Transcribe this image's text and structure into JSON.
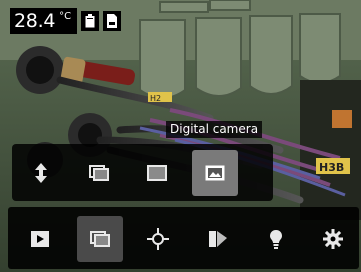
{
  "status": {
    "temperature": "28.4",
    "unit": "°C",
    "battery_icon": "battery-icon",
    "sd_card_icon": "sd-card-icon"
  },
  "tooltip": "Digital camera",
  "submenu": {
    "items": [
      {
        "name": "switch-orientation",
        "icon": "updown-arrow-icon",
        "selected": false
      },
      {
        "name": "picture-in-picture",
        "icon": "picture-in-picture-icon",
        "selected": false
      },
      {
        "name": "thermal",
        "icon": "thermal-image-icon",
        "selected": false
      },
      {
        "name": "digital-camera",
        "icon": "digital-camera-icon",
        "selected": true
      }
    ]
  },
  "mainbar": {
    "items": [
      {
        "name": "gallery",
        "icon": "play-icon",
        "selected": false
      },
      {
        "name": "image-mode",
        "icon": "image-mode-icon",
        "selected": true
      },
      {
        "name": "measurement",
        "icon": "crosshair-icon",
        "selected": false
      },
      {
        "name": "color-palette",
        "icon": "palette-icon",
        "selected": false
      },
      {
        "name": "lamp",
        "icon": "lamp-icon",
        "selected": false
      },
      {
        "name": "settings",
        "icon": "gear-icon",
        "selected": false
      }
    ]
  },
  "scene": {
    "label_left": "H2",
    "label_right": "H3B"
  }
}
